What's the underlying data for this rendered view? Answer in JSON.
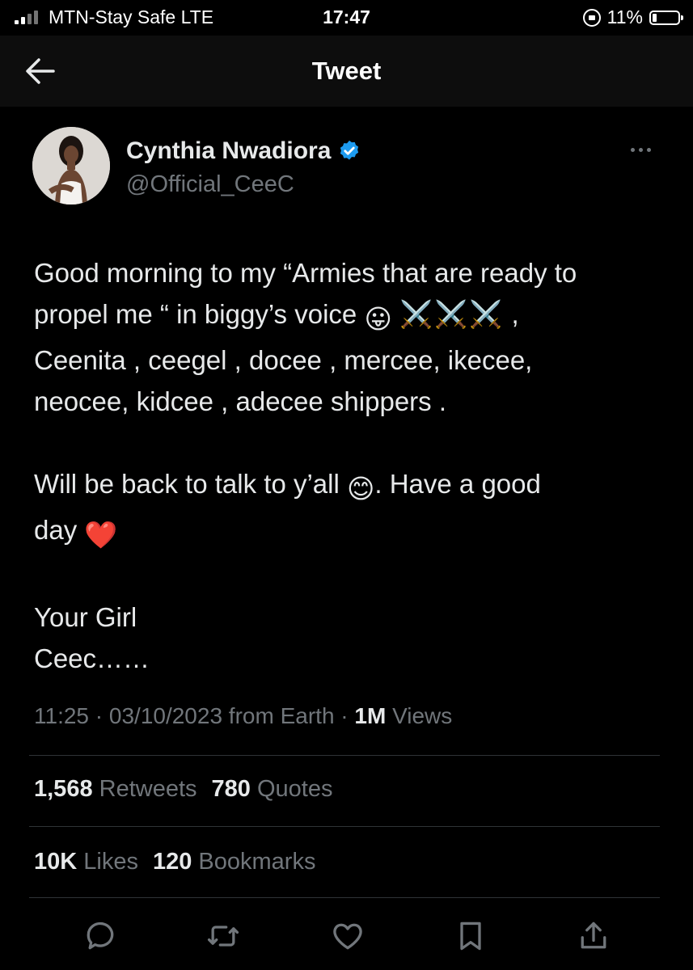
{
  "status_bar": {
    "carrier": "MTN-Stay Safe   LTE",
    "time": "17:47",
    "battery": "11%",
    "battery_level": 0.11
  },
  "header": {
    "title": "Tweet",
    "back_icon": "arrow-left-icon"
  },
  "author": {
    "name": "Cynthia Nwadiora",
    "handle": "@Official_CeeC",
    "verified": true,
    "verified_color": "#1d9bf0"
  },
  "tweet": {
    "line1": "Good morning to my “Armies that are ready to",
    "line2_text": "propel me “  in biggy’s voice ",
    "line2_emoji": "😛",
    "line2_swords": "⚔️⚔️⚔️",
    "line2_tail": " ,",
    "line3": "Ceenita , ceegel , docee , mercee, ikecee,",
    "line4": "neocee, kidcee , adecee shippers .",
    "line5_text": "Will be back to talk to y’all ",
    "line5_emoji": "😊",
    "line5_tail": ". Have a good",
    "line6_text": "day ",
    "line6_emoji": "❤️",
    "line7": "Your Girl",
    "line8": "Ceec……"
  },
  "meta": {
    "time": "11:25",
    "sep1": " · ",
    "date": "03/10/2023",
    "source": " from Earth",
    "sep2": " · ",
    "views_count": "1M",
    "views_label": " Views"
  },
  "stats": {
    "retweets_count": "1,568",
    "retweets_label": "Retweets",
    "quotes_count": "780",
    "quotes_label": "Quotes",
    "likes_count": "10K",
    "likes_label": "Likes",
    "bookmarks_count": "120",
    "bookmarks_label": "Bookmarks"
  },
  "actions": [
    "reply-icon",
    "retweet-icon",
    "like-icon",
    "bookmark-icon",
    "share-icon"
  ],
  "colors": {
    "background": "#000000",
    "text": "#e7e9ea",
    "muted": "#71767b",
    "divider": "#2f3336",
    "heart": "#e0245e"
  }
}
